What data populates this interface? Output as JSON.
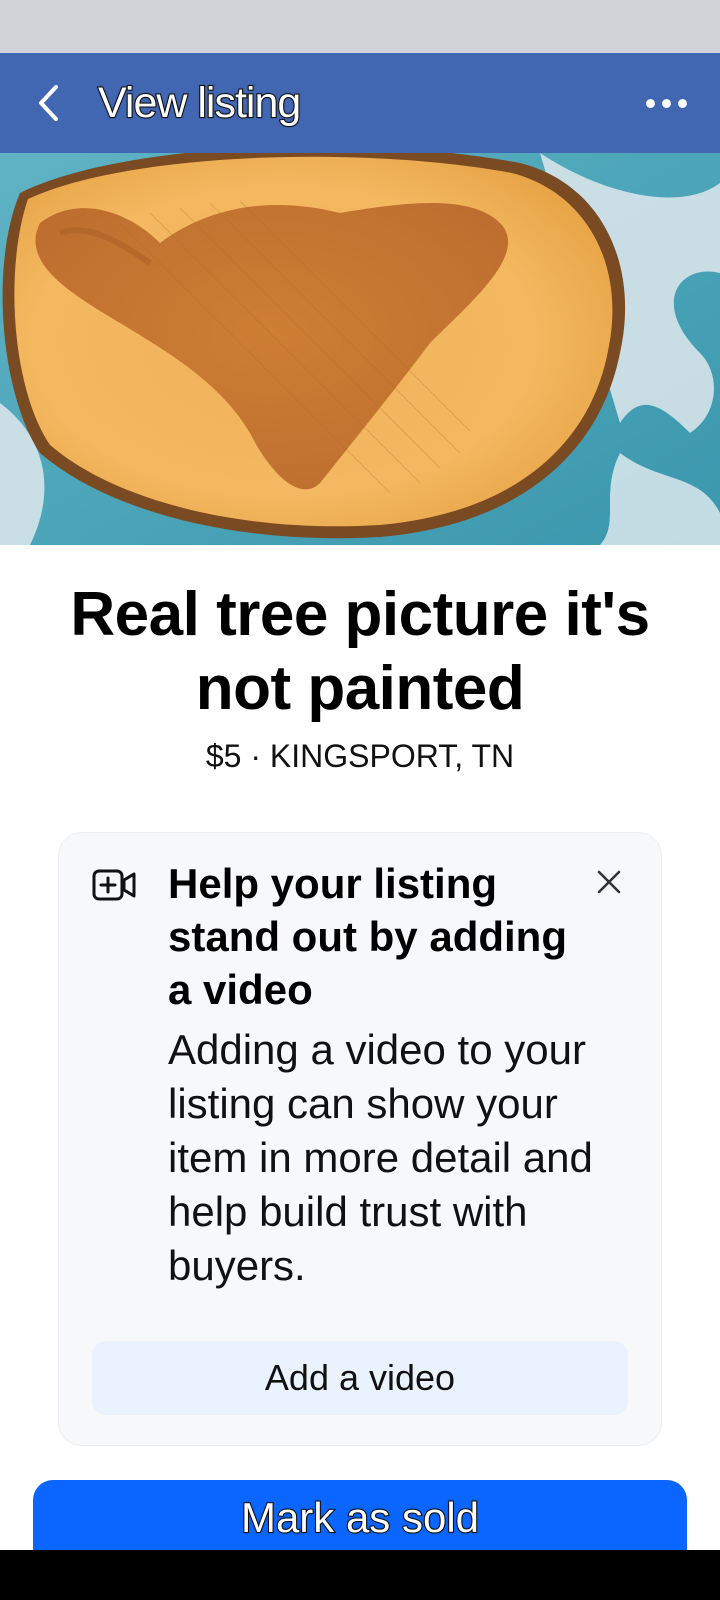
{
  "header": {
    "title": "View listing",
    "back_icon": "chevron-left-icon",
    "more_icon": "more-horizontal-icon"
  },
  "listing": {
    "photo_alt": "tree-slice-photo",
    "title": "Real tree picture it's not painted",
    "meta": "$5 · KINGSPORT, TN"
  },
  "video_prompt": {
    "icon": "add-video-icon",
    "heading": "Help your listing stand out by adding a video",
    "body": "Adding a video to your listing can show your item in more detail and help build trust with buyers.",
    "button_label": "Add a video",
    "close_icon": "close-icon"
  },
  "actions": {
    "mark_sold_label": "Mark as sold"
  },
  "colors": {
    "app_bar": "#4267b2",
    "primary_button": "#0a66ff",
    "card_bg": "#f7f8fa",
    "secondary_button": "#e9f2fd"
  }
}
